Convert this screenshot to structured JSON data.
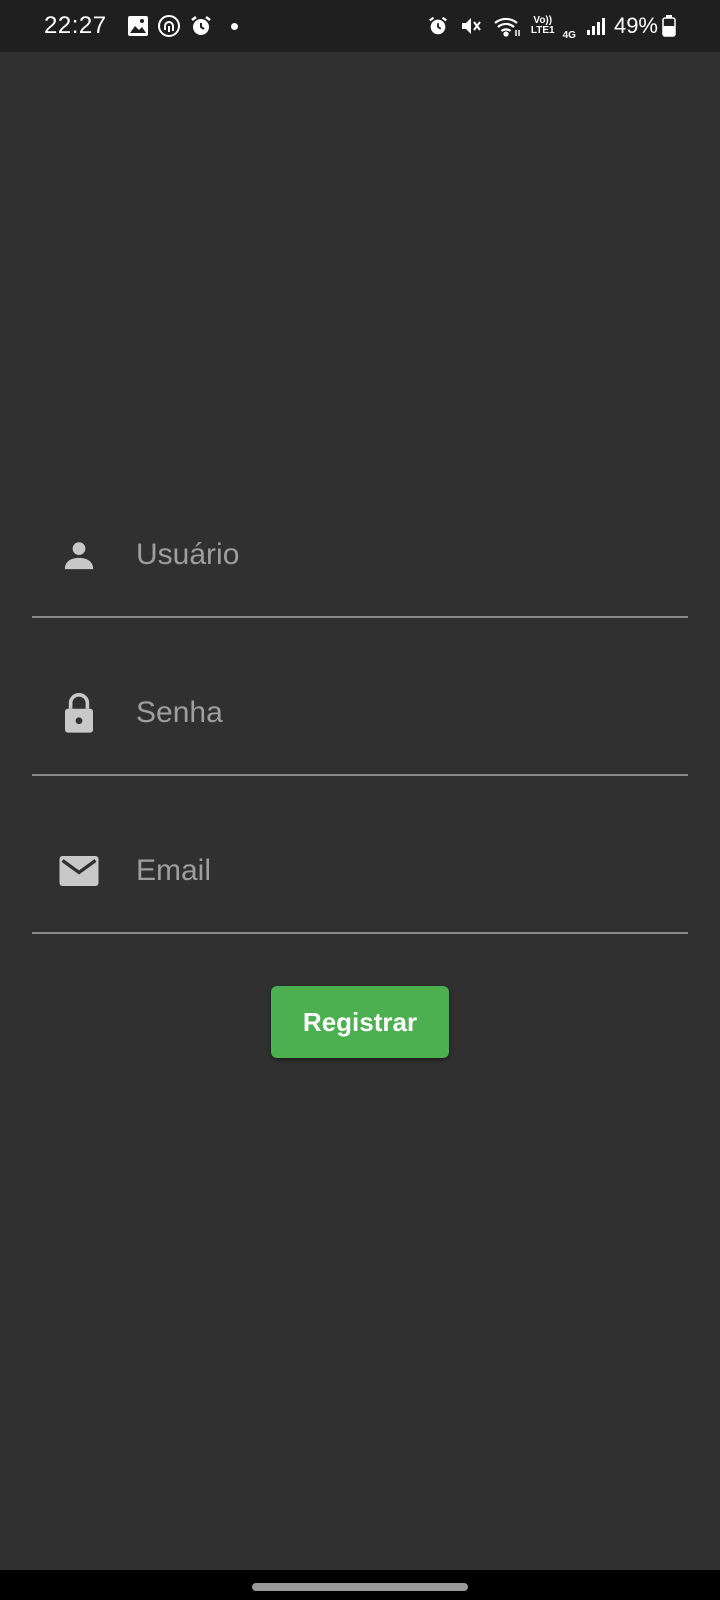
{
  "status_bar": {
    "time": "22:27",
    "left_icons": [
      "gallery-icon",
      "fingerprint-icon",
      "alarm-icon",
      "notification-dot"
    ],
    "right_icons": [
      "alarm-icon",
      "mute-icon",
      "wifi-icon",
      "volte-icon",
      "signal-icon",
      "battery-icon"
    ],
    "volte_top": "Vo))",
    "volte_bottom": "LTE1",
    "network": "4G",
    "battery": "49%"
  },
  "form": {
    "username": {
      "placeholder": "Usuário",
      "value": "",
      "icon": "person-icon"
    },
    "password": {
      "placeholder": "Senha",
      "value": "",
      "icon": "lock-icon"
    },
    "email": {
      "placeholder": "Email",
      "value": "",
      "icon": "mail-icon"
    }
  },
  "actions": {
    "register_label": "Registrar"
  },
  "colors": {
    "background": "#303030",
    "status_bar": "#1f1f1f",
    "accent_button": "#4caf50",
    "input_underline": "#8a8a8a",
    "placeholder": "#9e9e9e",
    "icon": "#c8c8c8"
  }
}
